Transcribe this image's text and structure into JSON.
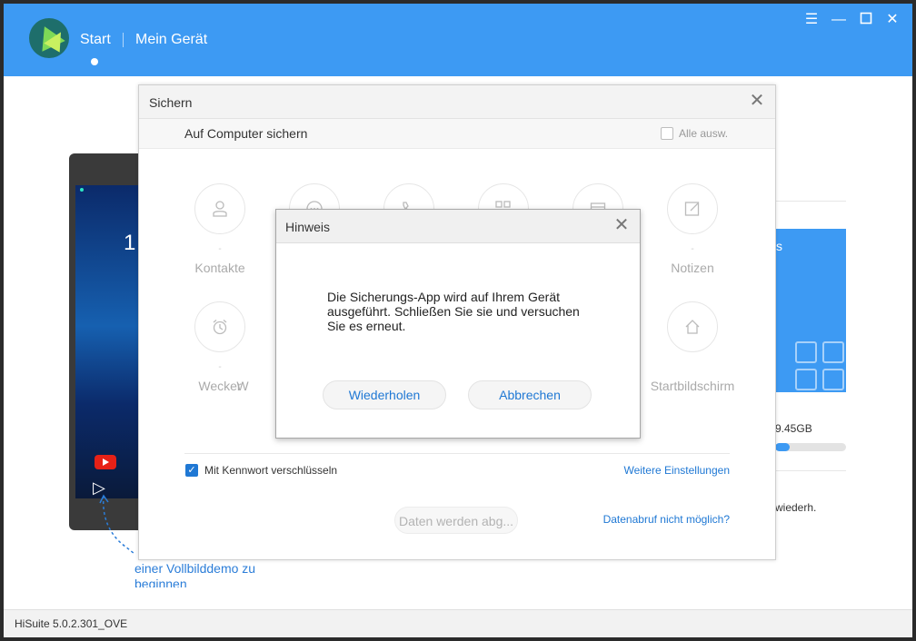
{
  "header": {
    "nav_start": "Start",
    "nav_device": "Mein Gerät",
    "window_controls": [
      "menu-icon",
      "minimize-icon",
      "maximize-icon",
      "close-icon"
    ]
  },
  "background": {
    "phone_clock": "1",
    "hint_line1": "einer Vollbilddemo zu",
    "hint_line2": "beginnen",
    "card_text": "s",
    "storage_text": "9.45GB",
    "storage_fraction": 0.2,
    "restore_text": "wiederh."
  },
  "backup_dialog": {
    "title": "Sichern",
    "subtitle": "Auf Computer sichern",
    "select_all_label": "Alle ausw.",
    "categories_row1": [
      {
        "label": "Kontakte",
        "icon": "contact-icon"
      },
      {
        "label": "",
        "icon": "message-icon"
      },
      {
        "label": "",
        "icon": "phone-icon"
      },
      {
        "label": "",
        "icon": "apps-icon"
      },
      {
        "label": "",
        "icon": "calendar-icon"
      },
      {
        "label": "Notizen",
        "icon": "note-icon"
      }
    ],
    "categories_row2": [
      {
        "label": "Wecker",
        "icon": "alarm-icon"
      },
      {
        "label": "W",
        "icon": ""
      },
      {
        "label": "Startbildschirm",
        "icon": "home-icon"
      }
    ],
    "encrypt_label": "Mit Kennwort verschlüsseln",
    "encrypt_checked": true,
    "more_settings": "Weitere Einstellungen",
    "fetch_button": "Daten werden abg...",
    "fetch_failed_link": "Datenabruf nicht möglich?"
  },
  "hint_dialog": {
    "title": "Hinweis",
    "message_line1": "Die Sicherungs-App wird auf Ihrem Gerät",
    "message_line2": "ausgeführt. Schließen Sie sie und versuchen",
    "message_line3": "Sie es erneut.",
    "retry_button": "Wiederholen",
    "cancel_button": "Abbrechen"
  },
  "statusbar": {
    "version": "HiSuite 5.0.2.301_OVE"
  },
  "colors": {
    "accent": "#3d9af3",
    "link": "#1f78d4"
  }
}
